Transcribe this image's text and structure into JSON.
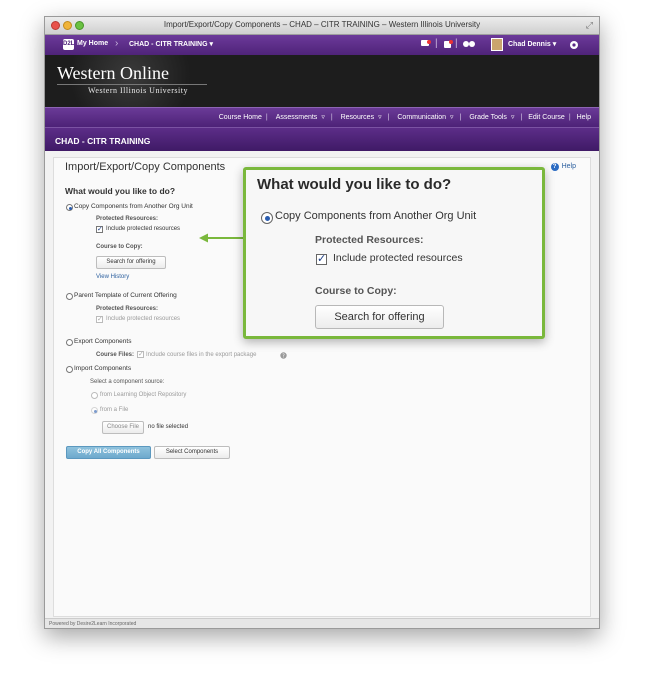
{
  "window": {
    "title": "Import/Export/Copy Components – CHAD – CITR TRAINING – Western Illinois University"
  },
  "minibar": {
    "logo_icon": "D2L",
    "my_home": "My Home",
    "chevron": "›",
    "org_unit": "CHAD - CITR TRAINING",
    "org_caret": "▾",
    "user": "Chad Dennis",
    "user_caret": "▾"
  },
  "header": {
    "logo_title": "Western Online",
    "logo_sub": "Western Illinois University"
  },
  "nav": {
    "items": [
      "Course Home",
      "Assessments",
      "Resources",
      "Communication",
      "Grade Tools",
      "Edit Course",
      "Help"
    ],
    "caret": "▿",
    "sep": "|"
  },
  "org_bar": {
    "title": "CHAD - CITR TRAINING"
  },
  "page": {
    "title": "Import/Export/Copy Components",
    "help": "Help",
    "help_icon": "?",
    "question": "What would you like to do?",
    "opt1": {
      "label": "Copy Components from Another Org Unit",
      "protected_label": "Protected Resources:",
      "include_label": "Include protected resources",
      "course_to_copy": "Course to Copy:",
      "search_button": "Search for offering",
      "view_history": "View History"
    },
    "opt2": {
      "label": "Parent Template of Current Offering",
      "protected_label": "Protected Resources:",
      "include_label": "Include protected resources"
    },
    "opt3": {
      "label": "Export Components",
      "files_label": "Course Files:",
      "include_files": "Include course files in the export package"
    },
    "opt4": {
      "label": "Import Components",
      "select_source": "Select a component source:",
      "from_lor": "from Learning Object Repository",
      "from_file": "from a File",
      "choose_file": "Choose File",
      "no_file": "no file selected"
    },
    "copy_all": "Copy All Components",
    "select_components": "Select Components",
    "checkmark": "✓"
  },
  "footer": {
    "text": "Powered by Desire2Learn Incorporated"
  },
  "callout": {
    "heading": "What would you like to do?",
    "radio_label": "Copy Components from Another Org Unit",
    "protected_label": "Protected Resources:",
    "include_label": "Include protected resources",
    "course_to_copy": "Course to Copy:",
    "search_button": "Search for offering"
  },
  "colors": {
    "purple": "#4f2379",
    "callout_border": "#7ab83c",
    "link": "#2b5f9e",
    "primary_button": "#6da9cd"
  }
}
